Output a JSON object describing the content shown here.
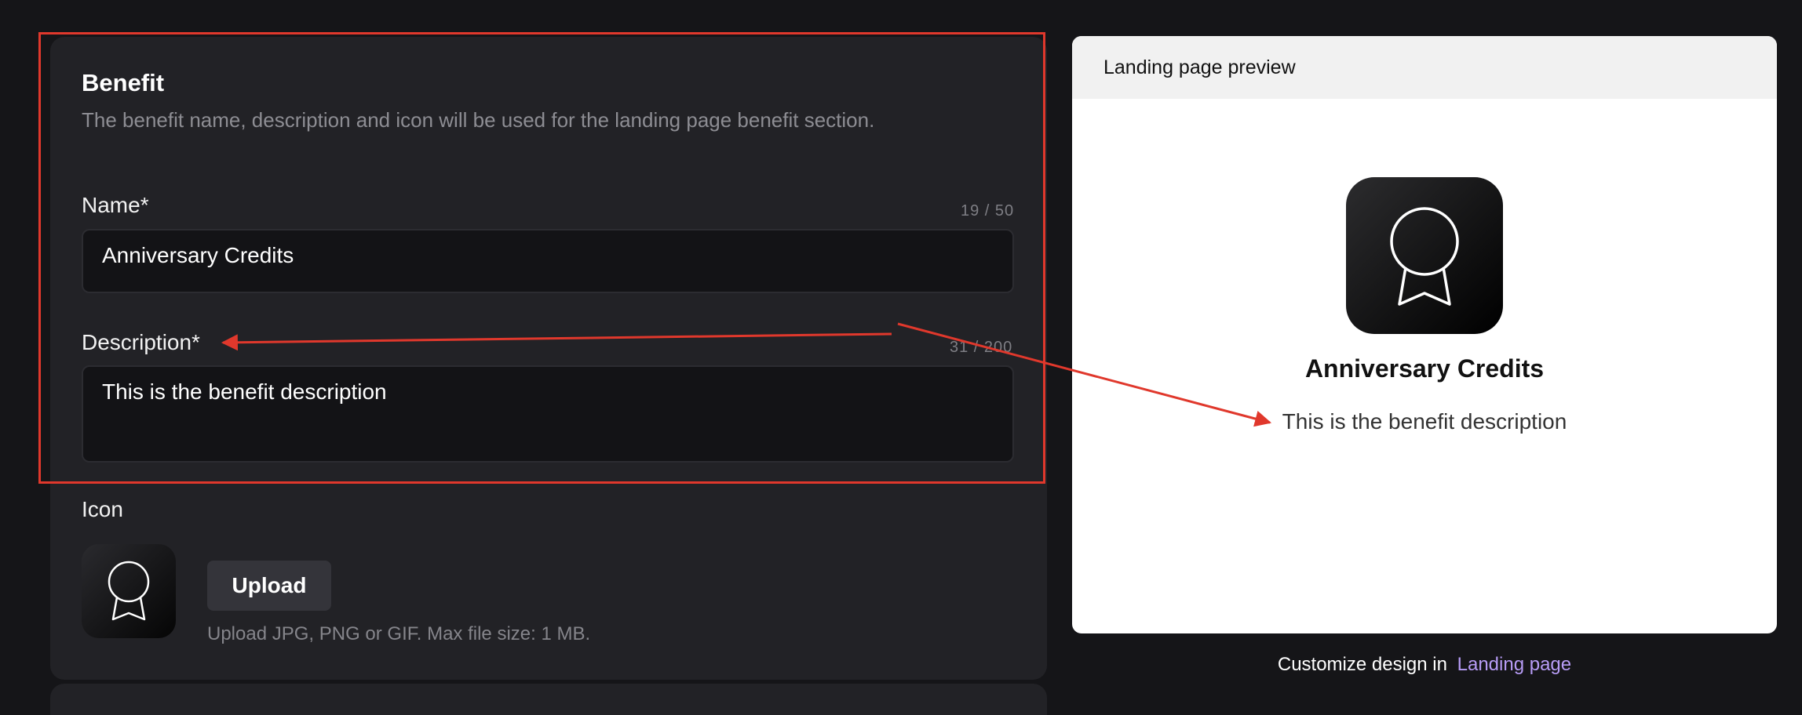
{
  "benefit": {
    "title": "Benefit",
    "description": "The benefit name, description and icon will be used for the landing page benefit section."
  },
  "name_field": {
    "label": "Name*",
    "counter": "19 / 50",
    "value": "Anniversary Credits"
  },
  "description_field": {
    "label": "Description*",
    "counter": "31 / 200",
    "value": "This is the benefit description"
  },
  "icon_field": {
    "label": "Icon",
    "upload_label": "Upload",
    "hint": "Upload JPG, PNG or GIF. Max file size: 1 MB.",
    "icon": "award-ribbon-icon"
  },
  "preview": {
    "header": "Landing page preview",
    "title": "Anniversary Credits",
    "description": "This is the benefit description",
    "icon": "award-ribbon-icon"
  },
  "footer": {
    "text": "Customize design in",
    "link": "Landing page",
    "link_color": "#b79cf6"
  },
  "annotation_color": "#e0382c"
}
